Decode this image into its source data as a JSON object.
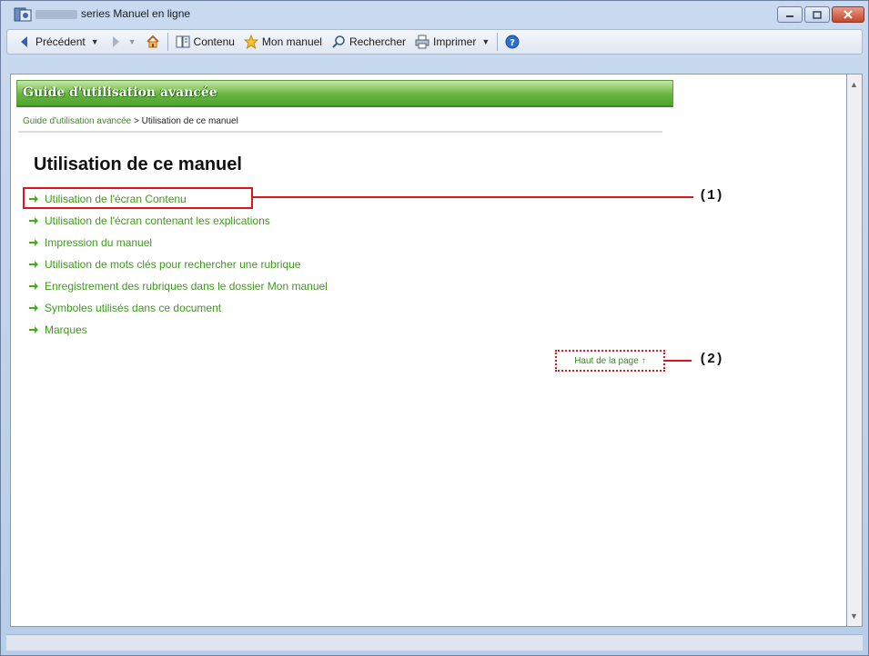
{
  "window": {
    "title": "series Manuel en ligne"
  },
  "toolbar": {
    "back_label": "Précédent",
    "contents_label": "Contenu",
    "mymanual_label": "Mon manuel",
    "search_label": "Rechercher",
    "print_label": "Imprimer"
  },
  "banner": {
    "title": "Guide d'utilisation avancée"
  },
  "breadcrumb": {
    "link": "Guide d'utilisation avancée",
    "separator": ">",
    "current": "Utilisation de ce manuel"
  },
  "page": {
    "title": "Utilisation de ce manuel",
    "links": [
      "Utilisation de l'écran Contenu",
      "Utilisation de l'écran contenant les explications",
      "Impression du manuel",
      "Utilisation de mots clés pour rechercher une rubrique",
      "Enregistrement des rubriques dans le dossier Mon manuel",
      "Symboles utilisés dans ce document",
      "Marques"
    ],
    "top_link": "Haut de la page",
    "top_link_arrow": "↑"
  },
  "callouts": {
    "label1": "(1)",
    "label2": "(2)"
  },
  "colors": {
    "link_green": "#3f9a1d",
    "callout_red": "#e0141a",
    "banner_green": "#66b640"
  }
}
